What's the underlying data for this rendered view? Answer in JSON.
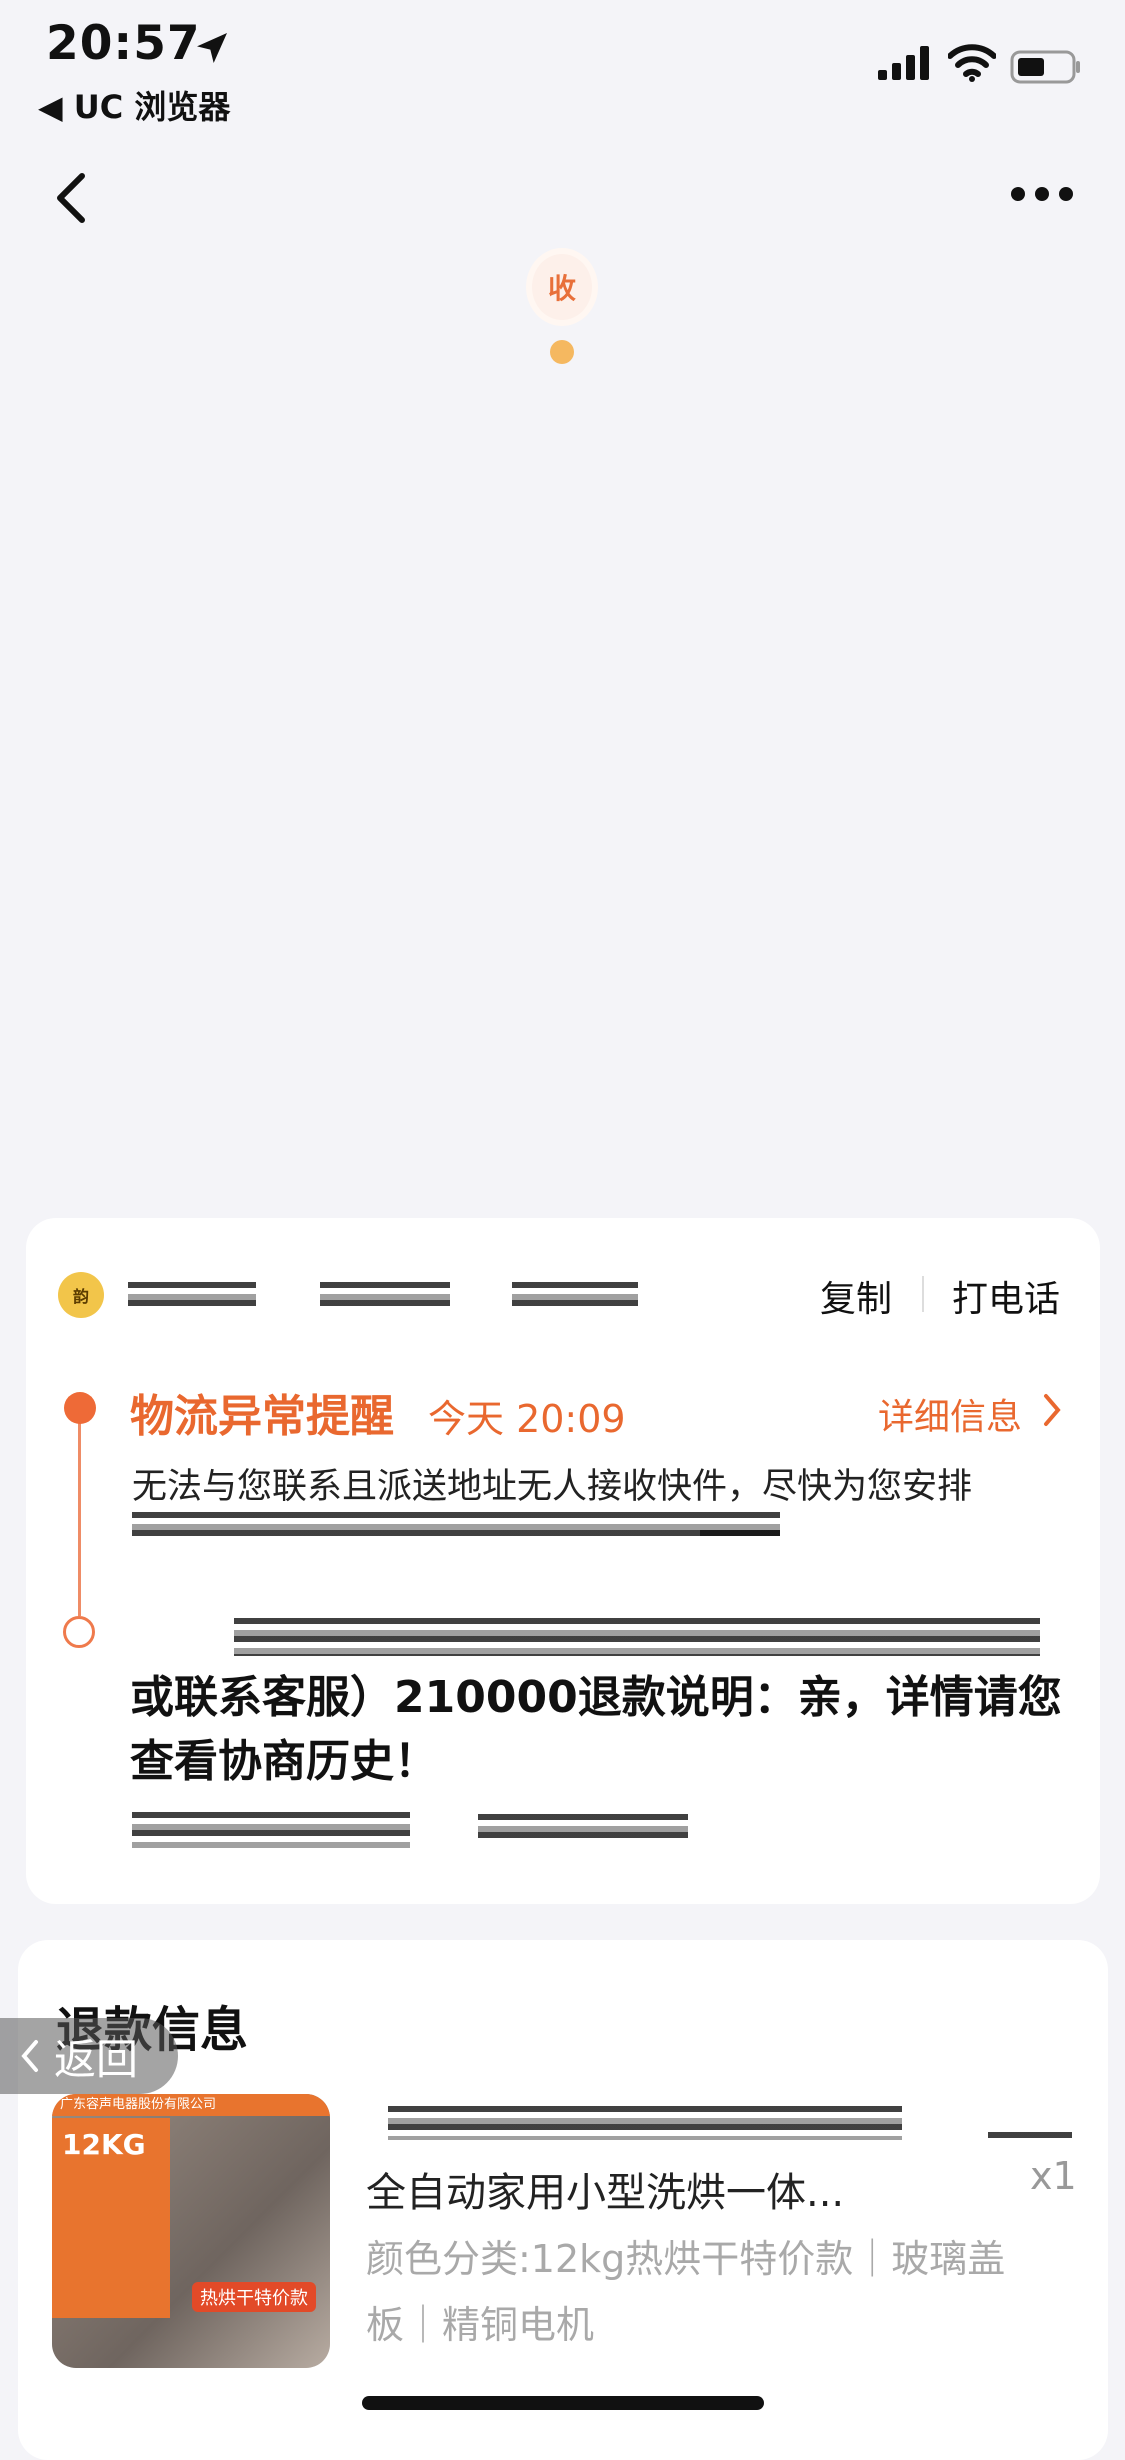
{
  "status_bar": {
    "time": "20:57",
    "back_app": "◀ UC 浏览器"
  },
  "map": {
    "marker_label": "收"
  },
  "logistics_card": {
    "copy_label": "复制",
    "call_label": "打电话",
    "alert_title": "物流异常提醒",
    "alert_time": "今天 20:09",
    "detail_label": "详细信息",
    "alert_body": "无法与您联系且派送地址无人接收快件，尽快为您安排",
    "refund_note": "或联系客服）210000退款说明：亲，详情请您查看协商历史！"
  },
  "refund_card": {
    "title": "退款信息",
    "back_label": "返回",
    "product": {
      "thumb_brand": "广东容声电器股份有限公司",
      "thumb_kg": "12KG",
      "thumb_tag": "热烘干特价款",
      "name": "全自动家用小型洗烘一体...",
      "qty": "x1",
      "spec": "颜色分类:12kg热烘干特价款｜玻璃盖板｜精铜电机"
    }
  },
  "colors": {
    "accent": "#e9682f",
    "background": "#f4f4f8"
  }
}
